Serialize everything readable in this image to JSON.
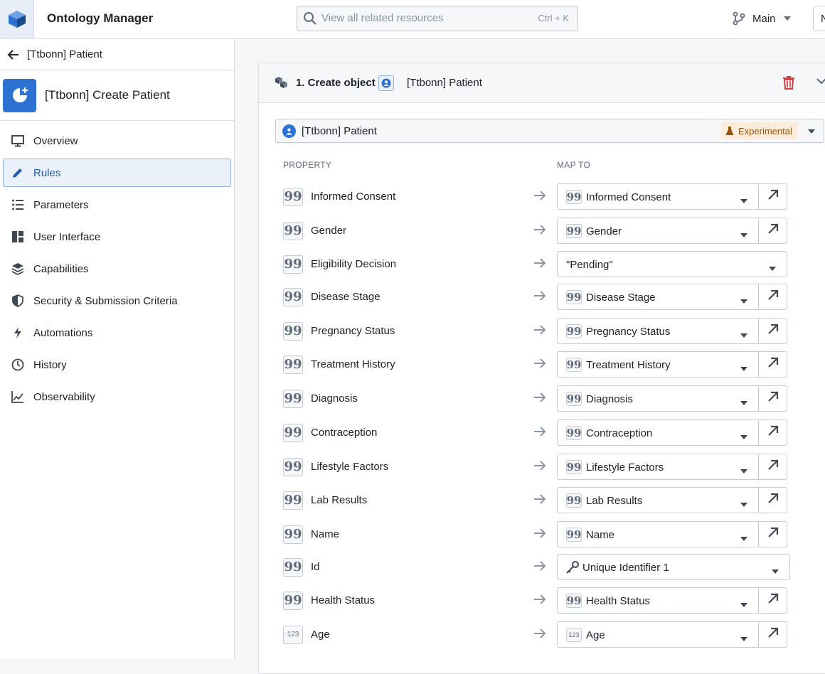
{
  "header": {
    "app_title": "Ontology Manager",
    "search_placeholder": "View all related resources",
    "search_shortcut": "Ctrl + K",
    "branch": "Main",
    "cut_button": "N"
  },
  "sidebar": {
    "back_label": "[Ttbonn] Patient",
    "action_title": "[Ttbonn] Create Patient",
    "nav": [
      {
        "label": "Overview",
        "icon": "monitor-icon"
      },
      {
        "label": "Rules",
        "icon": "pencil-icon",
        "active": true
      },
      {
        "label": "Parameters",
        "icon": "list-icon"
      },
      {
        "label": "User Interface",
        "icon": "layout-icon"
      },
      {
        "label": "Capabilities",
        "icon": "layers-icon"
      },
      {
        "label": "Security & Submission Criteria",
        "icon": "shield-icon"
      },
      {
        "label": "Automations",
        "icon": "lightning-icon"
      },
      {
        "label": "History",
        "icon": "clock-icon"
      },
      {
        "label": "Observability",
        "icon": "chart-icon"
      }
    ]
  },
  "rule": {
    "step_label": "1. Create object",
    "object_name": "[Ttbonn] Patient",
    "selected_object": "[Ttbonn] Patient",
    "badge": "Experimental",
    "col_property": "PROPERTY",
    "col_map_to": "MAP TO",
    "mappings": [
      {
        "property": "Informed Consent",
        "map_to": "Informed Consent"
      },
      {
        "property": "Gender",
        "map_to": "Gender"
      },
      {
        "property": "Eligibility Decision",
        "map_to": "\"Pending\""
      },
      {
        "property": "Disease Stage",
        "map_to": "Disease Stage"
      },
      {
        "property": "Pregnancy Status",
        "map_to": "Pregnancy Status"
      },
      {
        "property": "Treatment History",
        "map_to": "Treatment History"
      },
      {
        "property": "Diagnosis",
        "map_to": "Diagnosis"
      },
      {
        "property": "Contraception",
        "map_to": "Contraception"
      },
      {
        "property": "Lifestyle Factors",
        "map_to": "Lifestyle Factors"
      },
      {
        "property": "Lab Results",
        "map_to": "Lab Results"
      },
      {
        "property": "Name",
        "map_to": "Name"
      },
      {
        "property": "Id",
        "map_to": "Unique Identifier 1"
      },
      {
        "property": "Health Status",
        "map_to": "Health Status"
      },
      {
        "property": "Age",
        "map_to": "Age"
      }
    ],
    "string_glyph": "99",
    "number_glyph": "123"
  }
}
